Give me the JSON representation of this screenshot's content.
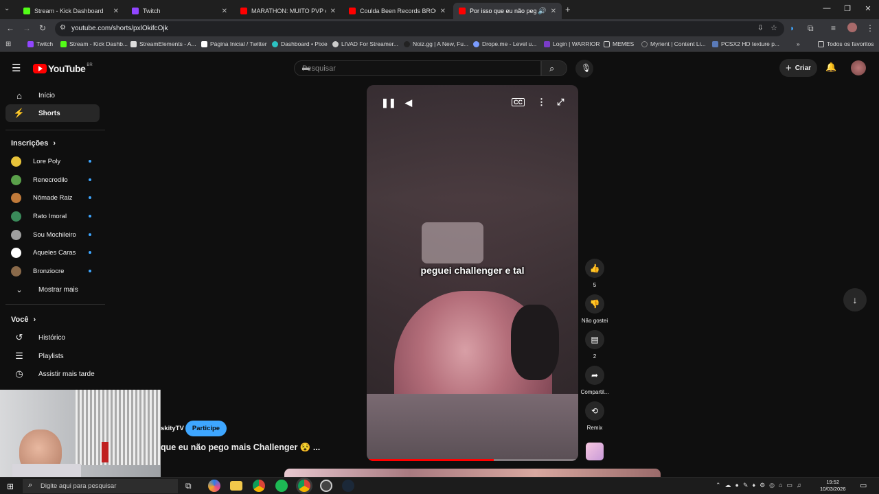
{
  "browser": {
    "tabs": [
      {
        "title": "Stream - Kick Dashboard",
        "color": "#53fc18"
      },
      {
        "title": "Twitch",
        "color": "#9146ff"
      },
      {
        "title": "MARATHON: MUITO PVP e EVE",
        "color": "#ff0000"
      },
      {
        "title": "Coulda Been Records BROOKLY",
        "color": "#ff0000"
      },
      {
        "title": "Por isso que eu não pego m",
        "color": "#ff0000"
      }
    ],
    "url": "youtube.com/shorts/pxlOkifcOjk",
    "bookmarks": [
      "Twitch",
      "Stream - Kick Dashb...",
      "StreamElements - A...",
      "Página Inicial / Twitter",
      "Dashboard • Pixie",
      "LIVAD For Streamer...",
      "Noiz.gg | A New, Fu...",
      "Drope.me - Level u...",
      "Login | WARRIOR",
      "MEMES",
      "Myrient | Content Li...",
      "PCSX2 HD texture p..."
    ],
    "all_bookmarks": "Todos os favoritos"
  },
  "youtube": {
    "logo": "YouTube",
    "country": "BR",
    "search_placeholder": "Pesquisar",
    "create_label": "Criar",
    "accent": "#3ea6ff",
    "sidebar": {
      "home": "Início",
      "shorts": "Shorts",
      "subscriptions_title": "Inscrições",
      "subscriptions": [
        {
          "name": "Lore Poly",
          "color": "#e8c33a"
        },
        {
          "name": "Renecrodilo",
          "color": "#5aa04a"
        },
        {
          "name": "Nômade Raiz",
          "color": "#c07a3a"
        },
        {
          "name": "Rato Imoral",
          "color": "#3a8a5a"
        },
        {
          "name": "Sou Mochileiro",
          "color": "#a0a0a0"
        },
        {
          "name": "Aqueles Caras",
          "color": "#ffffff"
        },
        {
          "name": "Bronziocre",
          "color": "#8a6a4a"
        }
      ],
      "show_more": "Mostrar mais",
      "you_title": "Você",
      "you_items": [
        "Histórico",
        "Playlists",
        "Assistir mais tarde"
      ]
    },
    "short": {
      "caption": "peguei challenger e tal",
      "progress": 0.6,
      "channel": "skityTV",
      "join_label": "Participe",
      "title": "que eu não pego mais Challenger 😵 ..."
    },
    "actions": [
      {
        "name": "like",
        "label": "5"
      },
      {
        "name": "dislike",
        "label": "Não gostei"
      },
      {
        "name": "comments",
        "label": "2"
      },
      {
        "name": "share",
        "label": "Compartil..."
      },
      {
        "name": "remix",
        "label": "Remix"
      }
    ]
  },
  "taskbar": {
    "search_placeholder": "Digite aqui para pesquisar",
    "time": "19:52",
    "date": "10/03/2026"
  }
}
